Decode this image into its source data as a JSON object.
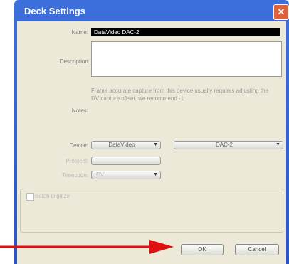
{
  "window": {
    "title": "Deck Settings",
    "close": "✕"
  },
  "fields": {
    "name_label": "Name:",
    "name_value": "DataVideo DAC-2",
    "description_label": "Description:",
    "notes_label": "Notes:",
    "notes_text": "Frame accurate capture from this device usually requires adjusting the DV capture offset, we recommend -1",
    "device_label": "Device:",
    "device_value": "DataVideo",
    "model_value": "DAC-2",
    "protocol_label": "Protocol:",
    "protocol_value": "",
    "timecode_label": "Timecode:",
    "timecode_value": "DV"
  },
  "group": {
    "checkbox_label": "Batch Digitize"
  },
  "buttons": {
    "ok": "OK",
    "cancel": "Cancel"
  },
  "colors": {
    "titlebar": "#2a55c8",
    "arrow": "#e01010"
  }
}
